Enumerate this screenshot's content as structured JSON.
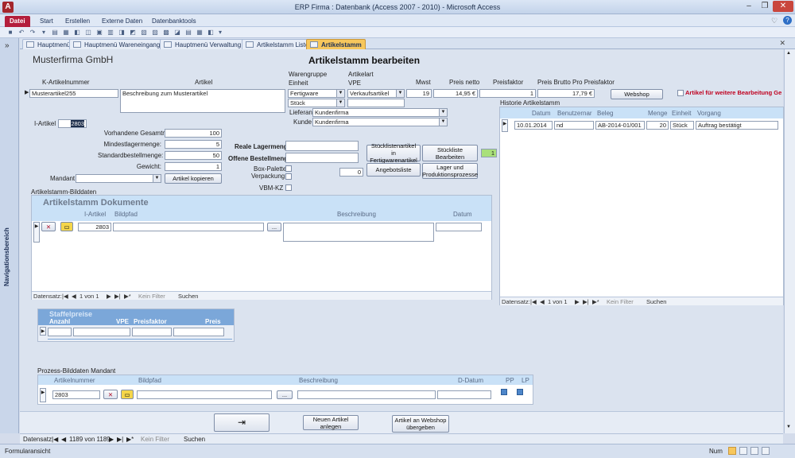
{
  "window": {
    "title": "ERP Firma : Datenbank (Access 2007 - 2010) - Microsoft Access",
    "app_icon": "A"
  },
  "ribbon": {
    "tabs": [
      "Datei",
      "Start",
      "Erstellen",
      "Externe Daten",
      "Datenbanktools"
    ]
  },
  "nav_pane": {
    "label": "Navigationsbereich",
    "toggle": "»"
  },
  "doc_tabs": [
    "Hauptmenü",
    "Hauptmenü Wareneingang",
    "Hauptmenü Verwaltung",
    "Artikelstamm Liste",
    "Artikelstamm"
  ],
  "form": {
    "company": "Musterfirma GmbH",
    "title": "Artikelstamm bearbeiten",
    "headers": {
      "k_artikelnummer": "K-Artikelnummer",
      "artikel": "Artikel",
      "warengruppe": "Warengruppe",
      "einheit": "Einheit",
      "artikelart": "Artikelart",
      "vpe": "VPE",
      "mwst": "Mwst",
      "preis_netto": "Preis netto",
      "preisfaktor": "Preisfaktor",
      "preis_brutto": "Preis Brutto Pro Preisfaktor"
    },
    "record": {
      "artikelnummer": "Musterartikel255",
      "beschreibung": "Beschreibung zum Musterartikel",
      "warengruppe": "Fertigware",
      "einheit": "Stück",
      "artikelart": "Verkaufsartikel",
      "vpe": "",
      "mwst": "19",
      "preis_netto": "14,95 €",
      "preisfaktor": "1",
      "preis_brutto": "17,79 €",
      "lieferant_label": "Lieferant",
      "lieferant": "Kundenfirma",
      "kunde_label": "Kunde",
      "kunde": "Kundenfirma",
      "i_artikel_label": "I-Artikel",
      "i_artikel": "2803"
    },
    "webshop_button": "Webshop",
    "webshop_check_label": "Artikel für weitere Bearbeitung Ge",
    "stock": [
      {
        "label": "Vorhandene Gesamtmenge:",
        "value": "100"
      },
      {
        "label": "Mindestlagermenge:",
        "value": "5"
      },
      {
        "label": "Standardbestellmenge:",
        "value": "50"
      },
      {
        "label": "Gewicht:",
        "value": "1"
      }
    ],
    "mandant_label": "Mandant",
    "kopieren_button": "Artikel kopieren",
    "reale_lagermenge": "Reale Lagermenge",
    "offene_bestellmenge": "Offene Bestellmenge",
    "box_palette": "Box-Palette",
    "verpackung": "Verpackung",
    "verpackung_value": "0",
    "vbm_kz": "VBM-KZ",
    "buttons": {
      "stueckliste_artikel": "Stücklistenartikel in Fertigwarenartikel",
      "stueckliste_bearbeiten": "Stückliste Bearbeiten",
      "angebotsliste": "Angebotsliste",
      "lager_prozesse": "Lager und Produktionsprozesse",
      "count": "1"
    },
    "bilddaten_label": "Artikelstamm-Bilddaten"
  },
  "dokumente": {
    "title": "Artikelstamm Dokumente",
    "cols": {
      "i_artikel": "I-Artikel",
      "bildpfad": "Bildpfad",
      "beschreibung": "Beschreibung",
      "datum": "Datum"
    },
    "row": {
      "i_artikel": "2803",
      "browse": "..."
    },
    "nav": {
      "label": "Datensatz:",
      "pos": "1 von 1",
      "filter": "Kein Filter",
      "search": "Suchen"
    }
  },
  "historie": {
    "title": "Historie Artikelstamm",
    "cols": {
      "datum": "Datum",
      "benutzer": "Benutzernar",
      "beleg": "Beleg",
      "menge": "Menge",
      "einheit": "Einheit",
      "vorgang": "Vorgang"
    },
    "row": {
      "datum": "10.01.2014",
      "benutzer": "nd",
      "beleg": "AB-2014-01/001",
      "menge": "20",
      "einheit": "Stück",
      "vorgang": "Auftrag bestätigt"
    },
    "nav": {
      "label": "Datensatz:",
      "pos": "1 von 1",
      "filter": "Kein Filter",
      "search": "Suchen"
    }
  },
  "staffelpreise": {
    "title": "Staffelpreise",
    "cols": {
      "anzahl": "Anzahl",
      "vpe": "VPE",
      "preisfaktor": "Preisfaktor",
      "preis": "Preis"
    }
  },
  "prozess": {
    "label": "Prozess-Bilddaten Mandant",
    "cols": {
      "artikelnummer": "Artikelnummer",
      "bildpfad": "Bildpfad",
      "beschreibung": "Beschreibung",
      "d_datum": "D-Datum",
      "pp": "PP",
      "lp": "LP"
    },
    "row": {
      "artikelnummer": "2803",
      "browse": "..."
    }
  },
  "footer_buttons": {
    "neu": "Neuen Artikel anlegen",
    "webshop": "Artikel an Webshop übergeben"
  },
  "bottom_nav": {
    "label": "Datensatz:",
    "pos": "1189 von 1189",
    "filter": "Kein Filter",
    "search": "Suchen"
  },
  "status": {
    "view": "Formularansicht",
    "num": "Num"
  }
}
